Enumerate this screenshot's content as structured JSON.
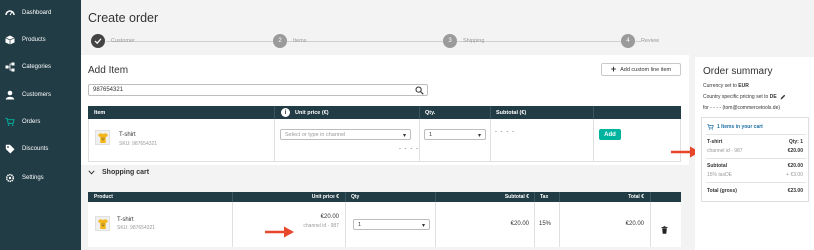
{
  "sidebar": {
    "items": [
      {
        "label": "Dashboard",
        "icon": "dashboard-icon"
      },
      {
        "label": "Products",
        "icon": "cube-icon"
      },
      {
        "label": "Categories",
        "icon": "tree-icon"
      },
      {
        "label": "Customers",
        "icon": "user-icon"
      },
      {
        "label": "Orders",
        "icon": "cart-icon"
      },
      {
        "label": "Discounts",
        "icon": "tag-icon"
      },
      {
        "label": "Settings",
        "icon": "gear-icon"
      }
    ]
  },
  "page": {
    "title": "Create order"
  },
  "stepper": {
    "steps": [
      {
        "number": "✓",
        "label": "Customer",
        "state": "done"
      },
      {
        "number": "2",
        "label": "Items",
        "state": "current"
      },
      {
        "number": "3",
        "label": "Shipping",
        "state": "todo"
      },
      {
        "number": "4",
        "label": "Review",
        "state": "todo"
      }
    ]
  },
  "add_item": {
    "title": "Add Item",
    "custom_line_button": "Add custom line item",
    "search_value": "987654321",
    "columns": [
      "Item",
      "Unit price (€)",
      "Qty.",
      "Subtotal (€)"
    ],
    "info_icon_text": "i",
    "row": {
      "name": "T-shirt",
      "sku": "SKU: 987654321",
      "price_placeholder": "Select or type in channel",
      "price_dashes": "- - - -",
      "qty": "1",
      "subtotal": "- - - -",
      "add_button": "Add"
    }
  },
  "cart": {
    "title": "Shopping cart",
    "columns": [
      "Product",
      "Unit price €",
      "Qty",
      "Subtotal €",
      "Tax",
      "Total €"
    ],
    "row": {
      "name": "T-shirt",
      "sku": "SKU: 987654321",
      "unit_price": "€20.00",
      "channel": "channel id - 987",
      "qty": "1",
      "subtotal": "€20.00",
      "tax": "15%",
      "total": "€20.00"
    }
  },
  "summary": {
    "title": "Order summary",
    "currency_prefix": "Currency set to ",
    "currency": "EUR",
    "country_prefix": "Country specific pricing set to ",
    "country": "DE",
    "for_line": "for - - - - (tom@commercetools.de)",
    "items_link": "1 Items in your cart",
    "item_name": "T-shirt",
    "item_qty": "Qty: 1",
    "item_channel": "channel id - 987",
    "item_price": "€20.00",
    "subtotal_label": "Subtotal",
    "subtotal_value": "€20.00",
    "tax_label": "15% taxDE",
    "tax_value": "+ €3.00",
    "total_label": "Total (gross)",
    "total_value": "€23.00"
  },
  "colors": {
    "sidebar_bg": "#213c45",
    "table_header": "#213c45",
    "accent": "#00b39e",
    "arrow": "#e8462b",
    "link": "#1d6fa5"
  }
}
